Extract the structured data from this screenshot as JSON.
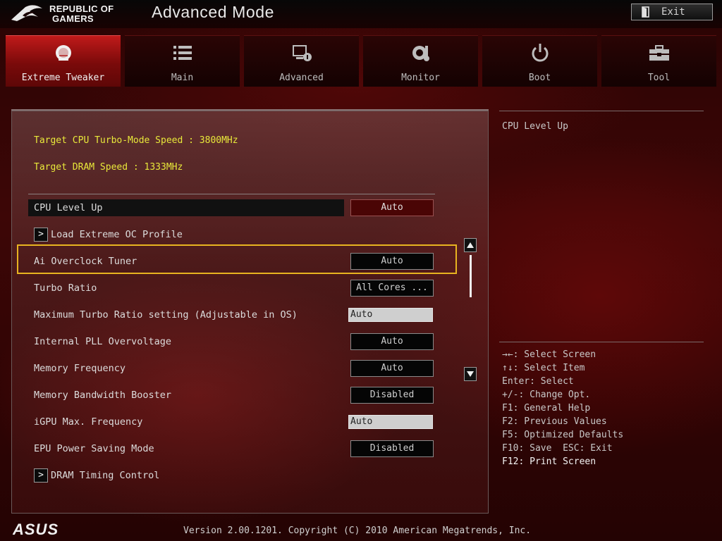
{
  "header": {
    "brand_line1": "REPUBLIC OF",
    "brand_line2": "GAMERS",
    "mode_title": "Advanced Mode",
    "exit_label": "Exit"
  },
  "tabs": [
    {
      "label": "Extreme Tweaker",
      "icon": "tweaker-icon",
      "active": true
    },
    {
      "label": "Main",
      "icon": "list-icon",
      "active": false
    },
    {
      "label": "Advanced",
      "icon": "advanced-settings-icon",
      "active": false
    },
    {
      "label": "Monitor",
      "icon": "monitor-gauge-icon",
      "active": false
    },
    {
      "label": "Boot",
      "icon": "power-icon",
      "active": false
    },
    {
      "label": "Tool",
      "icon": "toolbox-icon",
      "active": false
    }
  ],
  "main": {
    "info": [
      "Target CPU Turbo-Mode Speed : 3800MHz",
      "Target DRAM Speed : 1333MHz"
    ],
    "settings": [
      {
        "label": "CPU Level Up",
        "value": "Auto"
      },
      {
        "label": "Load Extreme OC Profile"
      },
      {
        "label": "Ai Overclock Tuner",
        "value": "Auto"
      },
      {
        "label": "Turbo Ratio",
        "value": "All Cores ..."
      },
      {
        "label": "Maximum Turbo Ratio setting (Adjustable in OS)",
        "value": "Auto"
      },
      {
        "label": "Internal PLL Overvoltage",
        "value": "Auto"
      },
      {
        "label": "Memory Frequency",
        "value": "Auto"
      },
      {
        "label": "Memory Bandwidth Booster",
        "value": "Disabled"
      },
      {
        "label": "iGPU Max. Frequency",
        "value": "Auto"
      },
      {
        "label": "EPU Power Saving Mode",
        "value": "Disabled"
      },
      {
        "label": "DRAM Timing Control"
      }
    ]
  },
  "help": {
    "title": "CPU Level Up",
    "hotkeys": [
      "→←: Select Screen",
      "↑↓: Select Item",
      "Enter: Select",
      "+/-: Change Opt.",
      "F1: General Help",
      "F2: Previous Values",
      "F5: Optimized Defaults",
      "F10: Save  ESC: Exit",
      "F12: Print Screen"
    ]
  },
  "footer": {
    "logo_text": "ASUS",
    "version": "Version 2.00.1201. Copyright (C) 2010 American Megatrends, Inc."
  },
  "colors": {
    "accent_red": "#c01a1a",
    "highlight_yellow": "#e8b420",
    "info_yellow": "#e8e83a"
  }
}
